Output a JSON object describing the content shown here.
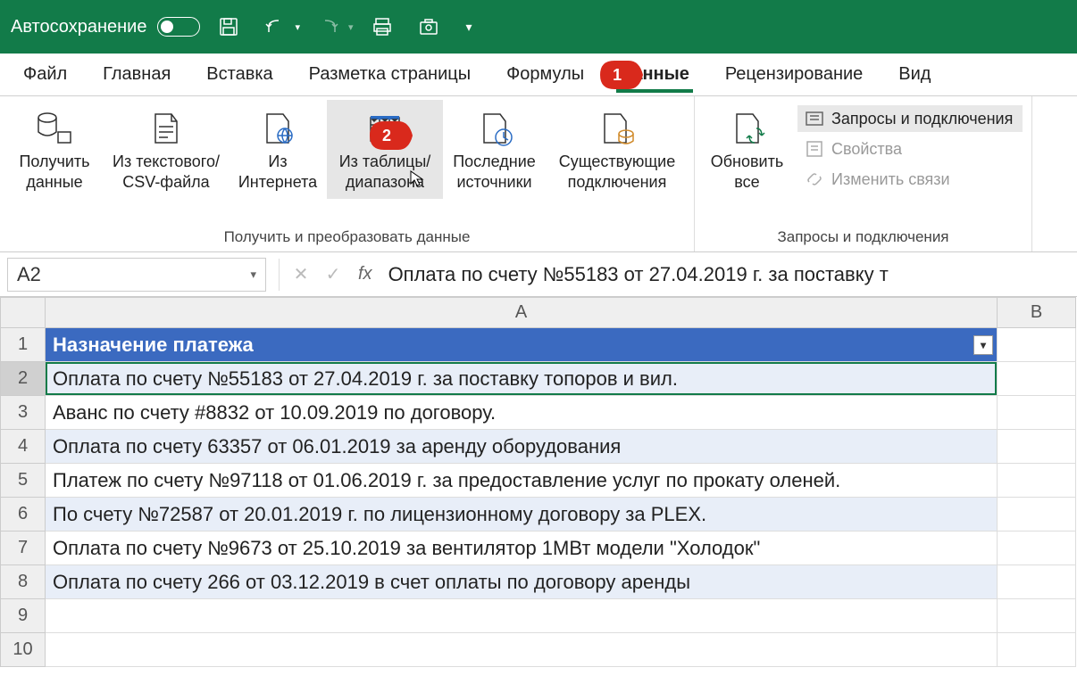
{
  "titlebar": {
    "autosave_label": "Автосохранение"
  },
  "tabs": [
    {
      "label": "Файл"
    },
    {
      "label": "Главная"
    },
    {
      "label": "Вставка"
    },
    {
      "label": "Разметка страницы"
    },
    {
      "label": "Формулы"
    },
    {
      "label": "Данные",
      "active": true
    },
    {
      "label": "Рецензирование"
    },
    {
      "label": "Вид"
    }
  ],
  "annotations": {
    "tab_badge": "1",
    "button_badge": "2"
  },
  "ribbon": {
    "group1": {
      "label": "Получить и преобразовать данные",
      "buttons": {
        "get_data": "Получить\nданные",
        "from_csv": "Из текстового/\nCSV-файла",
        "from_web": "Из\nИнтернета",
        "from_table": "Из таблицы/\nдиапазона",
        "recent": "Последние\nисточники",
        "existing": "Существующие\nподключения"
      }
    },
    "group2": {
      "label": "Запросы и подключения",
      "refresh_all": "Обновить\nвсе",
      "side": {
        "queries": "Запросы и подключения",
        "properties": "Свойства",
        "edit_links": "Изменить связи"
      }
    }
  },
  "formula_bar": {
    "name_box": "A2",
    "fx": "fx",
    "formula": "Оплата по счету №55183 от 27.04.2019 г. за поставку т"
  },
  "grid": {
    "columns": [
      "A",
      "B"
    ],
    "header": "Назначение платежа",
    "rows": [
      "Оплата по счету №55183 от 27.04.2019 г. за поставку топоров и вил.",
      "Аванс по счету #8832 от 10.09.2019 по договору.",
      "Оплата по счету 63357 от 06.01.2019 за аренду оборудования",
      "Платеж по счету №97118 от 01.06.2019 г. за предоставление услуг по прокату оленей.",
      "По счету №72587 от 20.01.2019 г. по лицензионному договору за PLEX.",
      "Оплата по счету №9673 от 25.10.2019 за вентилятор 1МВт модели \"Холодок\"",
      "Оплата по счету 266 от 03.12.2019 в счет оплаты по договору аренды"
    ],
    "row_labels": [
      "1",
      "2",
      "3",
      "4",
      "5",
      "6",
      "7",
      "8",
      "9",
      "10"
    ]
  }
}
